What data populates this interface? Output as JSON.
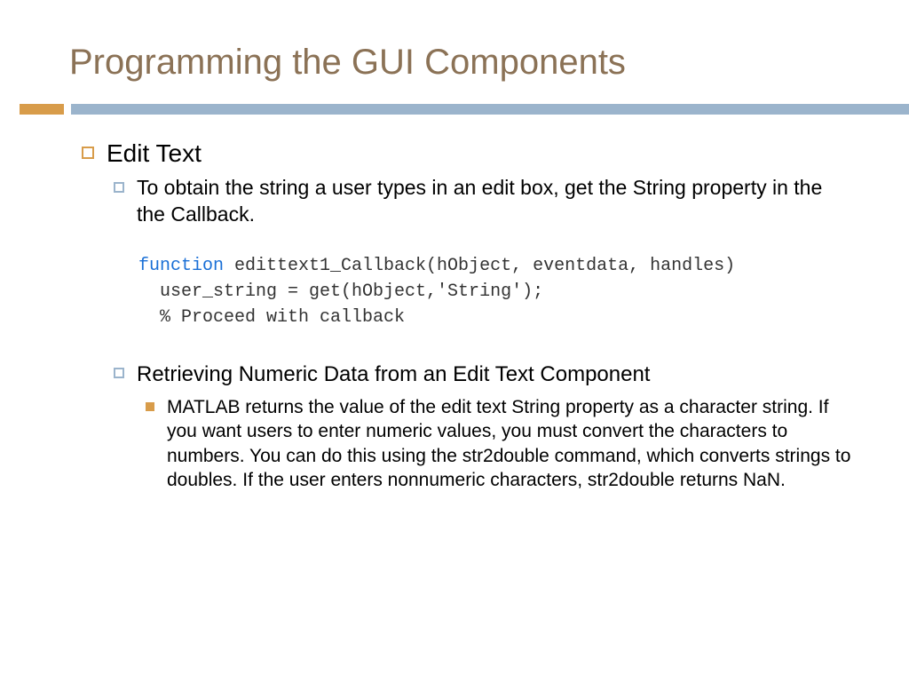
{
  "title": "Programming the GUI Components",
  "section": {
    "heading": "Edit Text",
    "intro": "To obtain the string a user types in an edit box, get the String property in the the Callback.",
    "code": {
      "keyword": "function",
      "line1_rest": " edittext1_Callback(hObject, eventdata, handles)",
      "line2": "  user_string = get(hObject,'String');",
      "line3": "  % Proceed with callback"
    },
    "sub": {
      "heading": "Retrieving Numeric Data from an Edit Text Component",
      "body": "MATLAB returns the value of the edit text String property as a character string. If you want users to enter numeric values, you must convert the characters to numbers. You can do this using the str2double command, which converts strings to doubles. If the user enters nonnumeric characters, str2double returns NaN."
    }
  }
}
